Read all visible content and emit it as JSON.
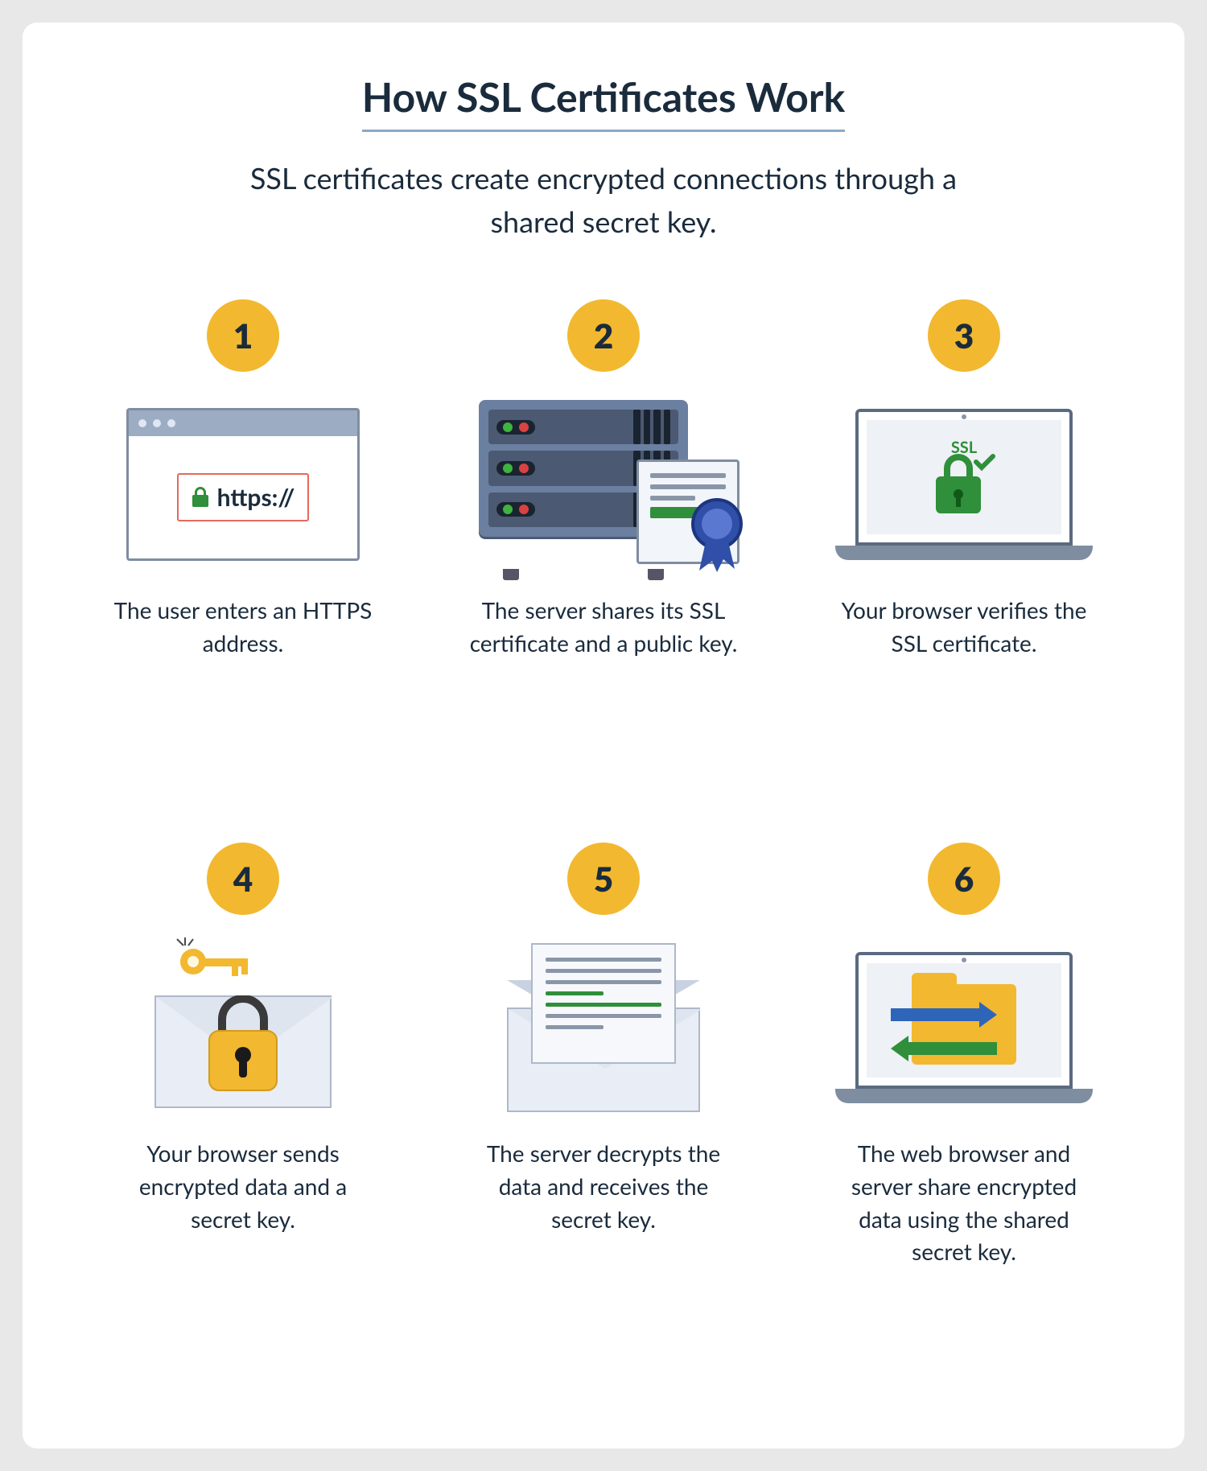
{
  "title": "How SSL Certificates Work",
  "subtitle": "SSL certificates create encrypted connections through a shared secret key.",
  "colors": {
    "badge_bg": "#f2b82f",
    "text": "#1a2b3c",
    "accent_blue": "#2f65b8",
    "accent_green": "#2f8f3a",
    "title_underline": "#8aa9c9"
  },
  "steps": [
    {
      "number": "1",
      "caption": "The user enters an HTTPS address.",
      "icon": "browser-https",
      "url_text": "https://"
    },
    {
      "number": "2",
      "caption": "The server shares its SSL certificate and a public key.",
      "icon": "server-certificate"
    },
    {
      "number": "3",
      "caption": "Your browser verifies the SSL certificate.",
      "icon": "laptop-ssl-lock",
      "ssl_label": "SSL"
    },
    {
      "number": "4",
      "caption": "Your browser sends encrypted data and a secret key.",
      "icon": "envelope-lock-key"
    },
    {
      "number": "5",
      "caption": "The server decrypts the data and receives the secret key.",
      "icon": "envelope-document"
    },
    {
      "number": "6",
      "caption": "The web browser and server share encrypted data using the shared secret key.",
      "icon": "laptop-folder-transfer"
    }
  ]
}
